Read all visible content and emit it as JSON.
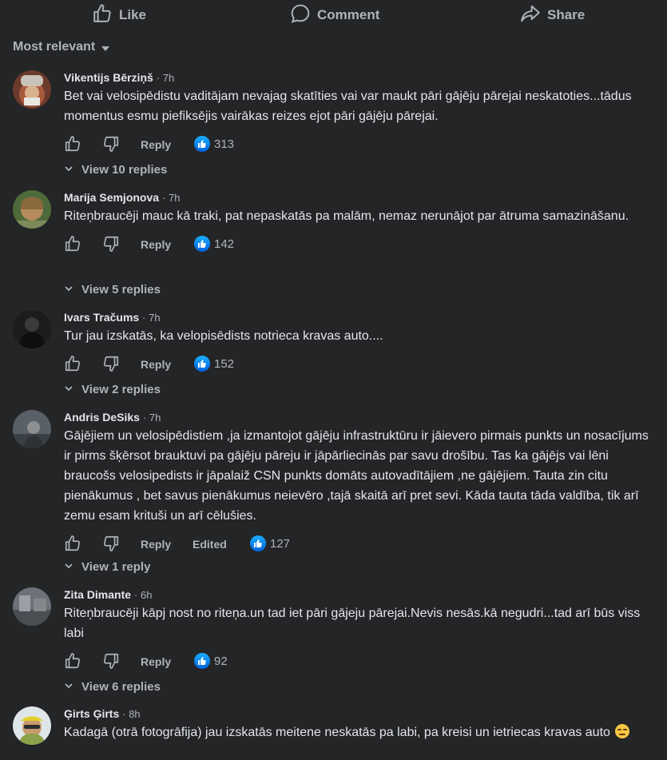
{
  "actions": {
    "like": "Like",
    "comment": "Comment",
    "share": "Share"
  },
  "sort_label": "Most relevant",
  "reply_label": "Reply",
  "comments": [
    {
      "author": "Vikentijs Bērziņš",
      "time": "7h",
      "text": "Bet vai velosipēdistu vaditājam nevajag skatīties vai var maukt pāri gājēju pārejai neskatoties...tādus momentus esmu piefiksējis vairākas reizes ejot pāri gājēju pārejai.",
      "reactions": "313",
      "replies": "View 10 replies"
    },
    {
      "author": "Marija Semjonova",
      "time": "7h",
      "text": "Riteņbraucēji mauc kā traki, pat nepaskatās pa malām, nemaz nerunājot par ātruma samazināšanu.",
      "reactions": "142",
      "replies": "View 5 replies"
    },
    {
      "author": "Ivars Tračums",
      "time": "7h",
      "text": "Tur jau izskatās, ka velopisēdists notrieca kravas auto....",
      "reactions": "152",
      "replies": "View 2 replies"
    },
    {
      "author": "Andris DeSiks",
      "time": "7h",
      "text": "Gājējiem un velosipēdistiem ,ja izmantojot gājēju infrastruktūru ir jāievero pirmais punkts un nosacījums ir pirms šķērsot brauktuvi pa gājēju pāreju ir jāpārliecinās par savu drošību. Tas ka gājējs vai lēni braucošs velosipedists ir jāpalaiž CSN punkts domāts autovadītājiem ,ne gājējiem. Tauta zin citu pienākumus , bet savus pienākumus neievēro ,tajā skaitā arī pret sevi. Kāda tauta tāda valdība, tik arī zemu esam krituši un arī cēlušies.",
      "edited": "Edited",
      "reactions": "127",
      "replies": "View 1 reply"
    },
    {
      "author": "Zita Dimante",
      "time": "6h",
      "text": "Riteņbraucēji kāpj nost no riteņa.un tad iet pāri gājeju pārejai.Nevis nesās.kā negudri...tad arī būs viss labi",
      "reactions": "92",
      "replies": "View 6 replies"
    },
    {
      "author": "Ģirts Ģirts",
      "time": "8h",
      "text": "Kadagā (otrā fotogrāfija) jau izskatās meitene neskatās pa labi, pa kreisi un ietriecas kravas auto",
      "emoji": "expressionless-face"
    }
  ],
  "colors": {
    "bg": "#242526",
    "text": "#e4e6eb",
    "muted": "#b0b3b8",
    "like_blue": "#1877f2"
  }
}
